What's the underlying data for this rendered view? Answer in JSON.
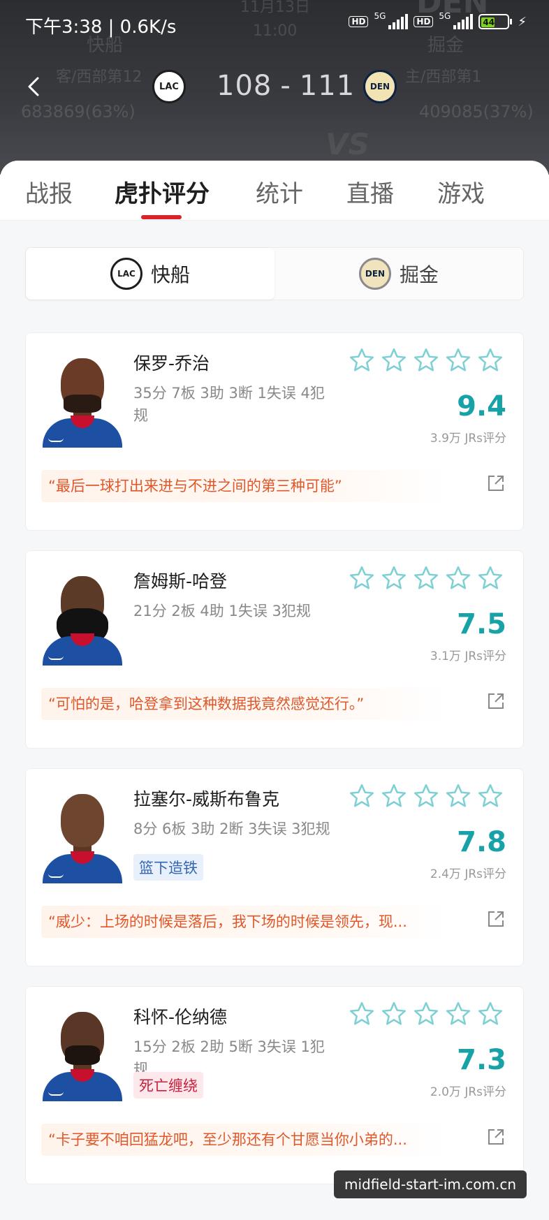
{
  "status_bar": {
    "time": "下午3:38 | 0.6K/s",
    "hd1": "HD",
    "net1": "5G",
    "hd2": "HD",
    "net2": "5G",
    "battery": "44"
  },
  "header": {
    "ghost_date": "11月13日",
    "ghost_time": "11:00",
    "ghost_home_short": "DEN",
    "away": {
      "name": "快船",
      "rank": "客/西部第12",
      "votes": "683869(63%)",
      "logo_text": "LAC"
    },
    "home": {
      "name": "掘金",
      "rank": "主/西部第1",
      "votes": "409085(37%)",
      "logo_text": "DEN"
    },
    "score_away": "108",
    "score_sep": "-",
    "score_home": "111",
    "vs": "VS"
  },
  "tabs": [
    {
      "label": "战报"
    },
    {
      "label": "虎扑评分"
    },
    {
      "label": "统计"
    },
    {
      "label": "直播"
    },
    {
      "label": "游戏"
    }
  ],
  "team_switch": {
    "left": {
      "label": "快船",
      "logo_text": "LAC"
    },
    "right": {
      "label": "掘金",
      "logo_text": "DEN"
    }
  },
  "players": [
    {
      "name": "保罗-乔治",
      "stats": "35分 7板 3助 3断 1失误 4犯规",
      "tag": "",
      "rating": "9.4",
      "jrs": "3.9万 JRs评分",
      "quote": "“最后一球打出来进与不进之间的第三种可能”"
    },
    {
      "name": "詹姆斯-哈登",
      "stats": "21分 2板 4助 1失误 3犯规",
      "tag": "",
      "rating": "7.5",
      "jrs": "3.1万 JRs评分",
      "quote": "“可怕的是，哈登拿到这种数据我竟然感觉还行。”"
    },
    {
      "name": "拉塞尔-威斯布鲁克",
      "stats": "8分 6板 3助 2断 3失误 3犯规",
      "tag": "篮下造铁",
      "rating": "7.8",
      "jrs": "2.4万 JRs评分",
      "quote": "“威少：上场的时候是落后，我下场的时候是领先，现..."
    },
    {
      "name": "科怀-伦纳德",
      "stats": "15分 2板 2助 5断 3失误 1犯规",
      "tag": "死亡缠绕",
      "rating": "7.3",
      "jrs": "2.0万 JRs评分",
      "quote": "“卡子要不咱回猛龙吧，至少那还有个甘愿当你小弟的..."
    }
  ],
  "watermark": "midfield-start-im.com.cn",
  "colors": {
    "accent_red": "#d8232a",
    "rating_teal": "#17a2a8",
    "quote_orange": "#e0572a"
  }
}
